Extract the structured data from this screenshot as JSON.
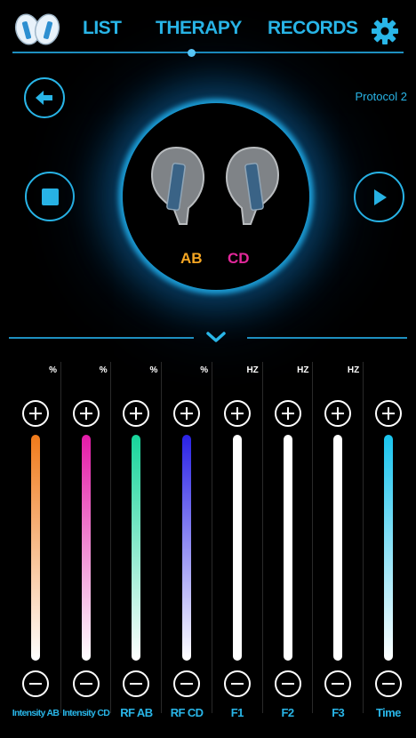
{
  "nav": {
    "tabs": [
      "LIST",
      "THERAPY",
      "RECORDS"
    ],
    "active_tab": "THERAPY"
  },
  "therapy": {
    "protocol": "Protocol 2",
    "label_ab": "AB",
    "label_cd": "CD",
    "color_ab": "#f5a623",
    "color_cd": "#e3289b"
  },
  "channels": [
    {
      "label": "Intensity AB",
      "unit": "%",
      "color": "#f07a1a"
    },
    {
      "label": "Intensity CD",
      "unit": "%",
      "color": "#e31ba8"
    },
    {
      "label": "RF AB",
      "unit": "%",
      "color": "#17d49a"
    },
    {
      "label": "RF CD",
      "unit": "%",
      "color": "#2a22e6"
    },
    {
      "label": "F1",
      "unit": "HZ",
      "color": "#ffffff"
    },
    {
      "label": "F2",
      "unit": "HZ",
      "color": "#ffffff"
    },
    {
      "label": "F3",
      "unit": "HZ",
      "color": "#ffffff"
    },
    {
      "label": "Time",
      "unit": "",
      "color": "#19c4ee"
    }
  ],
  "theme": {
    "accent": "#29b6e8",
    "background": "#000000"
  }
}
